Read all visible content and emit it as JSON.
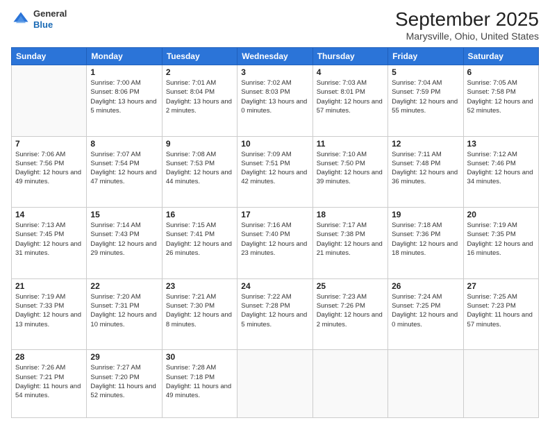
{
  "header": {
    "logo_general": "General",
    "logo_blue": "Blue",
    "title": "September 2025",
    "subtitle": "Marysville, Ohio, United States"
  },
  "days_of_week": [
    "Sunday",
    "Monday",
    "Tuesday",
    "Wednesday",
    "Thursday",
    "Friday",
    "Saturday"
  ],
  "weeks": [
    [
      {
        "day": "",
        "sunrise": "",
        "sunset": "",
        "daylight": ""
      },
      {
        "day": "1",
        "sunrise": "Sunrise: 7:00 AM",
        "sunset": "Sunset: 8:06 PM",
        "daylight": "Daylight: 13 hours and 5 minutes."
      },
      {
        "day": "2",
        "sunrise": "Sunrise: 7:01 AM",
        "sunset": "Sunset: 8:04 PM",
        "daylight": "Daylight: 13 hours and 2 minutes."
      },
      {
        "day": "3",
        "sunrise": "Sunrise: 7:02 AM",
        "sunset": "Sunset: 8:03 PM",
        "daylight": "Daylight: 13 hours and 0 minutes."
      },
      {
        "day": "4",
        "sunrise": "Sunrise: 7:03 AM",
        "sunset": "Sunset: 8:01 PM",
        "daylight": "Daylight: 12 hours and 57 minutes."
      },
      {
        "day": "5",
        "sunrise": "Sunrise: 7:04 AM",
        "sunset": "Sunset: 7:59 PM",
        "daylight": "Daylight: 12 hours and 55 minutes."
      },
      {
        "day": "6",
        "sunrise": "Sunrise: 7:05 AM",
        "sunset": "Sunset: 7:58 PM",
        "daylight": "Daylight: 12 hours and 52 minutes."
      }
    ],
    [
      {
        "day": "7",
        "sunrise": "Sunrise: 7:06 AM",
        "sunset": "Sunset: 7:56 PM",
        "daylight": "Daylight: 12 hours and 49 minutes."
      },
      {
        "day": "8",
        "sunrise": "Sunrise: 7:07 AM",
        "sunset": "Sunset: 7:54 PM",
        "daylight": "Daylight: 12 hours and 47 minutes."
      },
      {
        "day": "9",
        "sunrise": "Sunrise: 7:08 AM",
        "sunset": "Sunset: 7:53 PM",
        "daylight": "Daylight: 12 hours and 44 minutes."
      },
      {
        "day": "10",
        "sunrise": "Sunrise: 7:09 AM",
        "sunset": "Sunset: 7:51 PM",
        "daylight": "Daylight: 12 hours and 42 minutes."
      },
      {
        "day": "11",
        "sunrise": "Sunrise: 7:10 AM",
        "sunset": "Sunset: 7:50 PM",
        "daylight": "Daylight: 12 hours and 39 minutes."
      },
      {
        "day": "12",
        "sunrise": "Sunrise: 7:11 AM",
        "sunset": "Sunset: 7:48 PM",
        "daylight": "Daylight: 12 hours and 36 minutes."
      },
      {
        "day": "13",
        "sunrise": "Sunrise: 7:12 AM",
        "sunset": "Sunset: 7:46 PM",
        "daylight": "Daylight: 12 hours and 34 minutes."
      }
    ],
    [
      {
        "day": "14",
        "sunrise": "Sunrise: 7:13 AM",
        "sunset": "Sunset: 7:45 PM",
        "daylight": "Daylight: 12 hours and 31 minutes."
      },
      {
        "day": "15",
        "sunrise": "Sunrise: 7:14 AM",
        "sunset": "Sunset: 7:43 PM",
        "daylight": "Daylight: 12 hours and 29 minutes."
      },
      {
        "day": "16",
        "sunrise": "Sunrise: 7:15 AM",
        "sunset": "Sunset: 7:41 PM",
        "daylight": "Daylight: 12 hours and 26 minutes."
      },
      {
        "day": "17",
        "sunrise": "Sunrise: 7:16 AM",
        "sunset": "Sunset: 7:40 PM",
        "daylight": "Daylight: 12 hours and 23 minutes."
      },
      {
        "day": "18",
        "sunrise": "Sunrise: 7:17 AM",
        "sunset": "Sunset: 7:38 PM",
        "daylight": "Daylight: 12 hours and 21 minutes."
      },
      {
        "day": "19",
        "sunrise": "Sunrise: 7:18 AM",
        "sunset": "Sunset: 7:36 PM",
        "daylight": "Daylight: 12 hours and 18 minutes."
      },
      {
        "day": "20",
        "sunrise": "Sunrise: 7:19 AM",
        "sunset": "Sunset: 7:35 PM",
        "daylight": "Daylight: 12 hours and 16 minutes."
      }
    ],
    [
      {
        "day": "21",
        "sunrise": "Sunrise: 7:19 AM",
        "sunset": "Sunset: 7:33 PM",
        "daylight": "Daylight: 12 hours and 13 minutes."
      },
      {
        "day": "22",
        "sunrise": "Sunrise: 7:20 AM",
        "sunset": "Sunset: 7:31 PM",
        "daylight": "Daylight: 12 hours and 10 minutes."
      },
      {
        "day": "23",
        "sunrise": "Sunrise: 7:21 AM",
        "sunset": "Sunset: 7:30 PM",
        "daylight": "Daylight: 12 hours and 8 minutes."
      },
      {
        "day": "24",
        "sunrise": "Sunrise: 7:22 AM",
        "sunset": "Sunset: 7:28 PM",
        "daylight": "Daylight: 12 hours and 5 minutes."
      },
      {
        "day": "25",
        "sunrise": "Sunrise: 7:23 AM",
        "sunset": "Sunset: 7:26 PM",
        "daylight": "Daylight: 12 hours and 2 minutes."
      },
      {
        "day": "26",
        "sunrise": "Sunrise: 7:24 AM",
        "sunset": "Sunset: 7:25 PM",
        "daylight": "Daylight: 12 hours and 0 minutes."
      },
      {
        "day": "27",
        "sunrise": "Sunrise: 7:25 AM",
        "sunset": "Sunset: 7:23 PM",
        "daylight": "Daylight: 11 hours and 57 minutes."
      }
    ],
    [
      {
        "day": "28",
        "sunrise": "Sunrise: 7:26 AM",
        "sunset": "Sunset: 7:21 PM",
        "daylight": "Daylight: 11 hours and 54 minutes."
      },
      {
        "day": "29",
        "sunrise": "Sunrise: 7:27 AM",
        "sunset": "Sunset: 7:20 PM",
        "daylight": "Daylight: 11 hours and 52 minutes."
      },
      {
        "day": "30",
        "sunrise": "Sunrise: 7:28 AM",
        "sunset": "Sunset: 7:18 PM",
        "daylight": "Daylight: 11 hours and 49 minutes."
      },
      {
        "day": "",
        "sunrise": "",
        "sunset": "",
        "daylight": ""
      },
      {
        "day": "",
        "sunrise": "",
        "sunset": "",
        "daylight": ""
      },
      {
        "day": "",
        "sunrise": "",
        "sunset": "",
        "daylight": ""
      },
      {
        "day": "",
        "sunrise": "",
        "sunset": "",
        "daylight": ""
      }
    ]
  ]
}
